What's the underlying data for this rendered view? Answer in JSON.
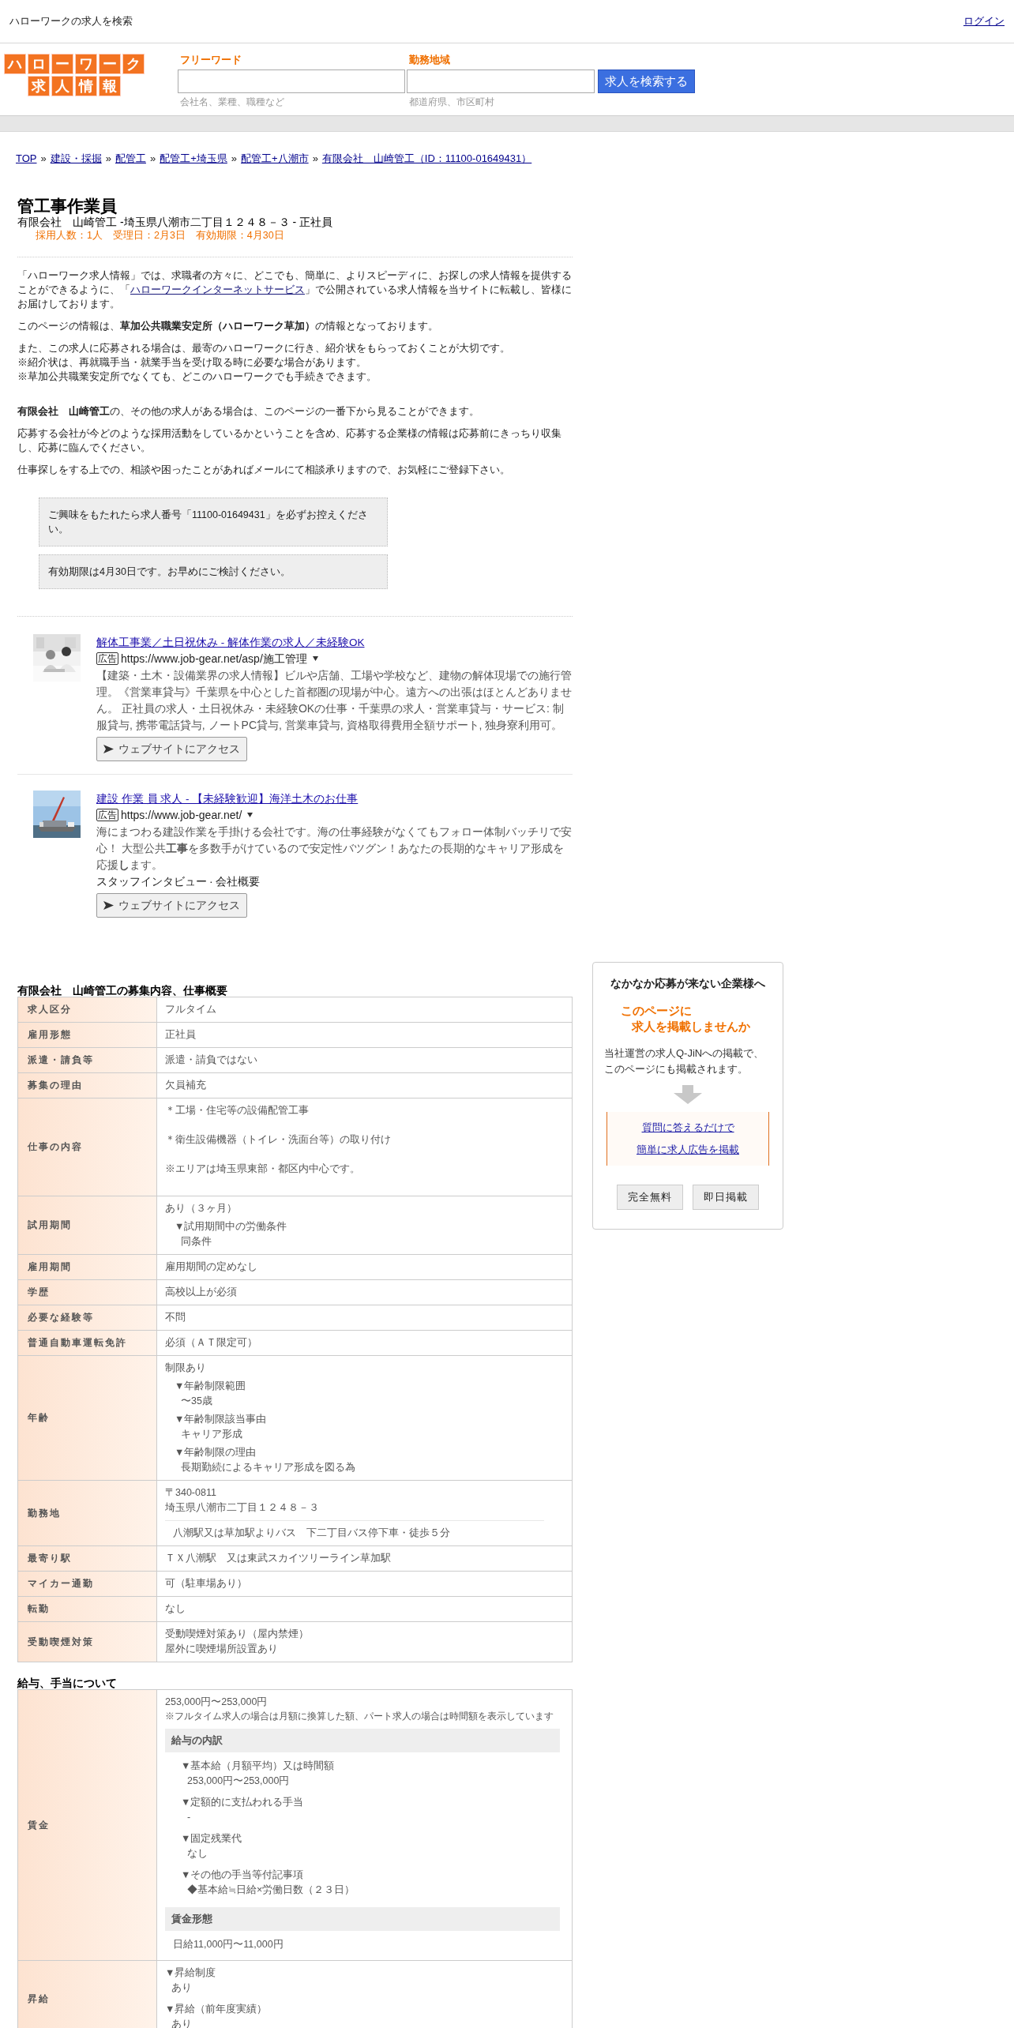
{
  "top_bar": {
    "title": "ハローワークの求人を検索",
    "login": "ログイン"
  },
  "header": {
    "logo": [
      "ハローワーク",
      "求人情報"
    ],
    "fields": [
      {
        "label": "フリーワード",
        "hint": "会社名、業種、職種など"
      },
      {
        "label": "勤務地域",
        "hint": "都道府県、市区町村"
      }
    ],
    "search_button": "求人を検索する"
  },
  "breadcrumb_separator": "»",
  "breadcrumb": [
    "TOP",
    "建設・採掘",
    "配管工",
    "配管工+埼玉県",
    "配管工+八潮市",
    "有限会社　山崎管工（ID：11100-01649431）"
  ],
  "job": {
    "title": "管工事作業員",
    "subtitle": "有限会社　山崎管工 -埼玉県八潮市二丁目１２４８－３ - 正社員",
    "meta": "採用人数：1人　受理日：2月3日　有効期限：4月30日"
  },
  "intro": {
    "lead": {
      "before": "「ハローワーク求人情報」では、求職者の方々に、どこでも、簡単に、よりスピーディに、お探しの求人情報を提供することができるように、「",
      "link": "ハローワークインターネットサービス",
      "after": "」で公開されている求人情報を当サイトに転載し、皆様にお届けしております。"
    },
    "paragraphs": [
      [
        "このページの情報は、**草加公共職業安定所（ハローワーク草加）**の情報となっております。"
      ],
      [
        "また、この求人に応募される場合は、最寄のハローワークに行き、紹介状をもらっておくことが大切です。",
        "※紹介状は、再就職手当・就業手当を受け取る時に必要な場合があります。",
        "※草加公共職業安定所でなくても、どこのハローワークでも手続きできます。"
      ],
      [
        "**有限会社　山崎管工**の、その他の求人がある場合は、このページの一番下から見ることができます。"
      ],
      [
        "応募する会社が今どのような採用活動をしているかということを含め、応募する企業様の情報は応募前にきっちり収集し、応募に臨んでください。"
      ],
      [
        "仕事探しをする上での、相談や困ったことがあればメールにて相談承りますので、お気軽にご登録下さい。"
      ]
    ]
  },
  "notices": [
    "ご興味をもたれたら求人番号「11100-01649431」を必ずお控えください。",
    "有効期限は4月30日です。お早めにご検討ください。"
  ],
  "ads": [
    {
      "kind": "picture",
      "title": "解体工事業／土日祝休み - 解体作業の求人／未経験OK",
      "badge": "広告",
      "url": "https://www.job-gear.net/asp/施工管理",
      "description": "【建築・土木・設備業界の求人情報】ビルや店舗、工場や学校など、建物の解体現場での施行管理。《営業車貸与》千葉県を中心とした首都圏の現場が中心。遠方への出張はほとんどありません。 正社員の求人・土日祝休み・未経験OKの仕事・千葉県の求人・営業車貸与・サービス: 制服貸与, 携帯電話貸与, ノートPC貸与, 営業車貸与, 資格取得費用全額サポート, 独身寮利用可。",
      "button": "ウェブサイトにアクセス"
    },
    {
      "kind": "picture",
      "title": "建設 作業 員 求人 - 【未経験歓迎】海洋土木のお仕事",
      "badge": "広告",
      "url": "https://www.job-gear.net/",
      "description": "海にまつわる建設作業を手掛ける会社です。海の仕事経験がなくてもフォロー体制バッチリで安心！ 大型公共**工事**を多数手がけているので安定性バツグン！あなたの長期的なキャリア形成を応援**し**ます。",
      "sitelinks": [
        "スタッフインタビュー",
        "会社概要"
      ],
      "sitelink_separator": "·",
      "button": "ウェブサイトにアクセス"
    }
  ],
  "overview": {
    "title": "有限会社　山崎管工の募集内容、仕事概要",
    "rows": [
      {
        "label": "求人区分",
        "blocks": [
          {
            "kind": "line",
            "text": "フルタイム"
          }
        ]
      },
      {
        "label": "雇用形態",
        "blocks": [
          {
            "kind": "line",
            "text": "正社員"
          }
        ]
      },
      {
        "label": "派遣・請負等",
        "blocks": [
          {
            "kind": "line",
            "text": "派遣・請負ではない"
          }
        ]
      },
      {
        "label": "募集の理由",
        "blocks": [
          {
            "kind": "line",
            "text": "欠員補充"
          }
        ]
      },
      {
        "label": "仕事の内容",
        "blocks": [
          {
            "kind": "para",
            "text": "＊工場・住宅等の設備配管工事"
          },
          {
            "kind": "para",
            "text": "＊衛生設備機器（トイレ・洗面台等）の取り付け"
          },
          {
            "kind": "para",
            "text": "※エリアは埼玉県東部・都区内中心です。"
          }
        ]
      },
      {
        "label": "試用期間",
        "blocks": [
          {
            "kind": "line",
            "text": "あり（３ヶ月）"
          },
          {
            "kind": "item",
            "title": "▼試用期間中の労働条件",
            "children": [
              "同条件"
            ]
          }
        ]
      },
      {
        "label": "雇用期間",
        "blocks": [
          {
            "kind": "line",
            "text": "雇用期間の定めなし"
          }
        ]
      },
      {
        "label": "学歴",
        "blocks": [
          {
            "kind": "line",
            "text": "高校以上が必須"
          }
        ]
      },
      {
        "label": "必要な経験等",
        "blocks": [
          {
            "kind": "line",
            "text": "不問"
          }
        ]
      },
      {
        "label": "普通自動車運転免許",
        "blocks": [
          {
            "kind": "line",
            "text": "必須（ＡＴ限定可）"
          }
        ]
      },
      {
        "label": "年齢",
        "blocks": [
          {
            "kind": "line",
            "text": "制限あり"
          },
          {
            "kind": "item",
            "title": "▼年齢制限範囲",
            "children": [
              "〜35歳"
            ]
          },
          {
            "kind": "item",
            "title": "▼年齢制限該当事由",
            "children": [
              "キャリア形成"
            ]
          },
          {
            "kind": "item",
            "title": "▼年齢制限の理由",
            "children": [
              "長期勤続によるキャリア形成を図る為"
            ]
          }
        ]
      },
      {
        "label": "勤務地",
        "blocks": [
          {
            "kind": "line",
            "text": "〒340-0811"
          },
          {
            "kind": "line",
            "text": "埼玉県八潮市二丁目１２４８－３"
          },
          {
            "kind": "access",
            "text": "八潮駅又は草加駅よりバス　下二丁目バス停下車・徒歩５分"
          }
        ]
      },
      {
        "label": "最寄り駅",
        "blocks": [
          {
            "kind": "line",
            "text": "ＴＸ八潮駅　又は東武スカイツリーライン草加駅"
          }
        ]
      },
      {
        "label": "マイカー通勤",
        "blocks": [
          {
            "kind": "line",
            "text": "可（駐車場あり）"
          }
        ]
      },
      {
        "label": "転勤",
        "blocks": [
          {
            "kind": "line",
            "text": "なし"
          }
        ]
      },
      {
        "label": "受動喫煙対策",
        "blocks": [
          {
            "kind": "line",
            "text": "受動喫煙対策あり（屋内禁煙）"
          },
          {
            "kind": "line",
            "text": "屋外に喫煙場所設置あり"
          }
        ]
      }
    ]
  },
  "wages": {
    "title": "給与、手当について",
    "rows": [
      {
        "label": "賃金",
        "blocks": [
          {
            "kind": "line",
            "text": "253,000円〜253,000円"
          },
          {
            "kind": "note",
            "text": "※フルタイム求人の場合は月額に換算した額、パート求人の場合は時間額を表示しています"
          },
          {
            "kind": "heading",
            "title": "給与の内訳",
            "children": [
              {
                "kind": "item",
                "title": "▼基本給（月額平均）又は時間額",
                "children": [
                  "253,000円〜253,000円"
                ]
              },
              {
                "kind": "item",
                "title": "▼定額的に支払われる手当",
                "children": [
                  "-"
                ]
              },
              {
                "kind": "item",
                "title": "▼固定残業代",
                "children": [
                  "なし"
                ]
              },
              {
                "kind": "item",
                "title": "▼その他の手当等付記事項",
                "children": [
                  "◆基本給≒日給×労働日数（２３日）"
                ]
              }
            ]
          },
          {
            "kind": "heading",
            "title": "賃金形態",
            "children": [
              {
                "kind": "access_plain",
                "text": "日給11,000円〜11,000円"
              }
            ]
          }
        ]
      },
      {
        "label": "昇給",
        "blocks": [
          {
            "kind": "item",
            "title": "▼昇給制度",
            "children": [
              "あり"
            ]
          },
          {
            "kind": "item",
            "title": "▼昇給（前年度実績）",
            "children": [
              "あり"
            ]
          }
        ]
      }
    ]
  },
  "side": {
    "title": "なかなか応募が来ない企業様へ",
    "catch": [
      "このページに",
      "求人を掲載しませんか"
    ],
    "text": [
      "当社運営の求人Q-JiNへの掲載で、",
      "このページにも掲載されます。"
    ],
    "links": [
      "質問に答えるだけで",
      "簡単に求人広告を掲載"
    ],
    "badges": [
      "完全無料",
      "即日掲載"
    ]
  }
}
